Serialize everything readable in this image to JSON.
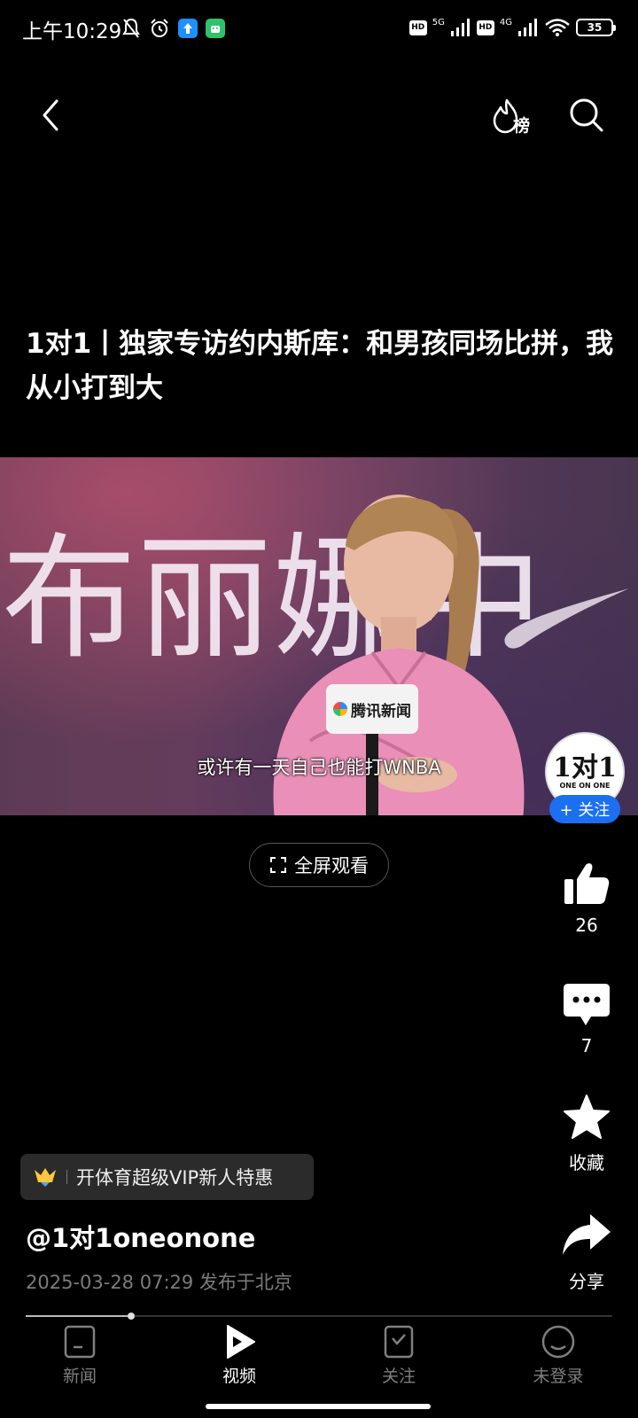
{
  "status_bar": {
    "time": "上午10:29",
    "network_5g": "5G",
    "network_4g": "4G",
    "hd_1": "HD",
    "hd_2": "HD",
    "battery": "35"
  },
  "top_nav": {
    "rank_label": "榜"
  },
  "video": {
    "title": "1对1丨独家专访约内斯库：和男孩同场比拼，我从小打到大",
    "backdrop_text": "布丽娜中",
    "mic_flag": "腾讯新闻",
    "subtitle": "或许有一天自己也能打WNBA",
    "progress": 0.18
  },
  "author": {
    "avatar_logo": "1对1",
    "avatar_sub": "ONE ON ONE",
    "follow_label": "+ 关注",
    "name": "@1对1oneonone",
    "meta": "2025-03-28 07:29 发布于北京"
  },
  "fullscreen_label": "全屏观看",
  "actions": {
    "like_count": "26",
    "comment_count": "7",
    "favorite_label": "收藏",
    "share_label": "分享"
  },
  "vip_banner": {
    "text": "开体育超级VIP新人特惠"
  },
  "bottom_nav": {
    "items": [
      {
        "label": "新闻",
        "icon": "news-icon"
      },
      {
        "label": "视频",
        "icon": "video-icon",
        "active": true
      },
      {
        "label": "关注",
        "icon": "follow-icon"
      },
      {
        "label": "未登录",
        "icon": "profile-icon"
      }
    ]
  },
  "colors": {
    "background": "#000000",
    "follow_blue": "#1d6ff2",
    "meta_gray": "#7c7c7c"
  }
}
